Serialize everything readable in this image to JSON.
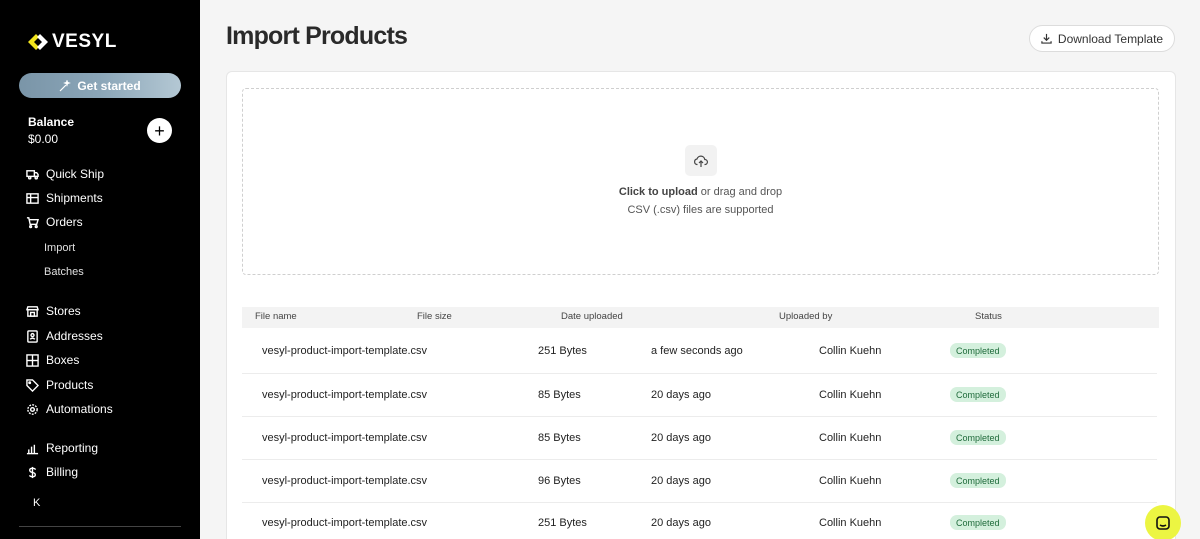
{
  "app": {
    "brand": "VESYL",
    "get_started": "Get started"
  },
  "balance": {
    "label": "Balance",
    "value": "$0.00",
    "add": "+"
  },
  "nav": {
    "quick_ship": "Quick Ship",
    "shipments": "Shipments",
    "orders": "Orders",
    "import": "Import",
    "batches": "Batches",
    "stores": "Stores",
    "addresses": "Addresses",
    "boxes": "Boxes",
    "products": "Products",
    "automations": "Automations",
    "reporting": "Reporting",
    "billing": "Billing",
    "collapse": "K"
  },
  "page": {
    "title": "Import Products",
    "download_template": "Download Template"
  },
  "upload": {
    "click": "Click to upload",
    "rest": " or drag and drop",
    "hint": "CSV (.csv) files are supported"
  },
  "table": {
    "headers": {
      "file_name": "File name",
      "file_size": "File size",
      "date_uploaded": "Date uploaded",
      "uploaded_by": "Uploaded by",
      "status": "Status"
    },
    "rows": [
      {
        "file_name": "vesyl-product-import-template.csv",
        "size": "251 Bytes",
        "date": "a few seconds ago",
        "by": "Collin Kuehn",
        "status": "Completed"
      },
      {
        "file_name": "vesyl-product-import-template.csv",
        "size": "85 Bytes",
        "date": "20 days ago",
        "by": "Collin Kuehn",
        "status": "Completed"
      },
      {
        "file_name": "vesyl-product-import-template.csv",
        "size": "85 Bytes",
        "date": "20 days ago",
        "by": "Collin Kuehn",
        "status": "Completed"
      },
      {
        "file_name": "vesyl-product-import-template.csv",
        "size": "96 Bytes",
        "date": "20 days ago",
        "by": "Collin Kuehn",
        "status": "Completed"
      },
      {
        "file_name": "vesyl-product-import-template.csv",
        "size": "251 Bytes",
        "date": "20 days ago",
        "by": "Collin Kuehn",
        "status": "Completed"
      }
    ]
  },
  "colors": {
    "sidebar_bg": "#000000",
    "badge_bg": "#d4f0dd",
    "badge_text": "#1f6b3b",
    "chat_bubble": "#ecf542"
  }
}
